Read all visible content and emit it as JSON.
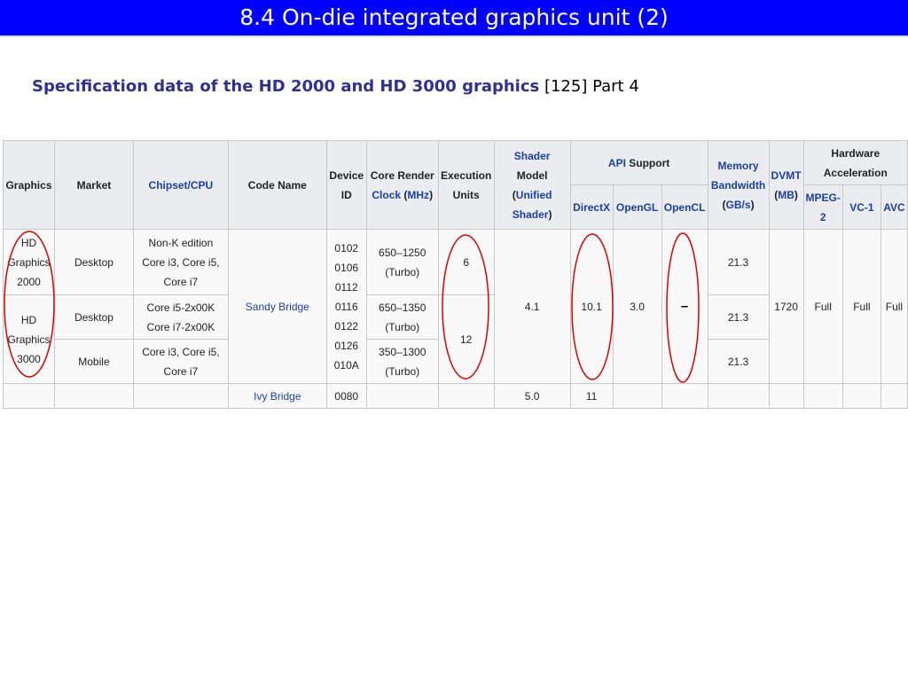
{
  "slide": {
    "title": "8.4 On-die integrated graphics unit (2)",
    "subtitle_bold": "Specification data of the HD 2000 and HD 3000 graphics",
    "subtitle_rest": " [125] Part 4"
  },
  "table": {
    "headers": {
      "graphics": "Graphics",
      "market": "Market",
      "chipset_cpu": "Chipset/CPU",
      "code_name": "Code Name",
      "device_id_1": "Device",
      "device_id_2": "ID",
      "core_clock_1": "Core Render",
      "core_clock_link1": "Clock",
      "core_clock_open": " (",
      "core_clock_link2": "MHz",
      "core_clock_close": ")",
      "eu_1": "Execution",
      "eu_2": "Units",
      "shader_link": "Shader",
      "shader_model": "Model",
      "shader_open": "(",
      "shader_unified_link": "Unified",
      "shader_link2": "Shader",
      "shader_close": ")",
      "api_link": "API",
      "api_support": " Support",
      "directx": "DirectX",
      "opengl": "OpenGL",
      "opencl": "OpenCL",
      "mem_link1": "Memory",
      "mem_link2": "Bandwidth",
      "mem_open": "(",
      "mem_unit_link": "GB/s",
      "mem_close": ")",
      "dvmt_link": "DVMT",
      "dvmt_open": "(",
      "dvmt_unit_link": "MB",
      "dvmt_close": ")",
      "hw_accel_1": "Hardware",
      "hw_accel_2": "Acceleration",
      "mpeg2_1": "MPEG-",
      "mpeg2_2": "2",
      "vc1": "VC-1",
      "avc": "AVC"
    },
    "rows": {
      "r1": {
        "graphics_1": "HD",
        "graphics_2": "Graphics",
        "graphics_3": "2000",
        "market": "Desktop",
        "chipset_1": "Non-K edition",
        "chipset_2": "Core i3, Core i5,",
        "chipset_3": "Core i7",
        "clock_1": "650–1250",
        "clock_2": "(Turbo)",
        "eu": "6",
        "mem_bw": "21.3"
      },
      "r2": {
        "graphics_1": "HD",
        "graphics_2": "Graphics",
        "graphics_3": "3000",
        "market": "Desktop",
        "chipset_1": "Core i5-2x00K",
        "chipset_2": "Core i7-2x00K",
        "clock_1": "650–1350",
        "clock_2": "(Turbo)",
        "eu": "12",
        "mem_bw": "21.3"
      },
      "r3": {
        "market": "Mobile",
        "chipset_1": "Core i3, Core i5,",
        "chipset_2": "Core i7",
        "clock_1": "350–1300",
        "clock_2": "(Turbo)",
        "mem_bw": "21.3"
      },
      "shared": {
        "code_name": "Sandy Bridge",
        "device_ids": [
          "0102",
          "0106",
          "0112",
          "0116",
          "0122",
          "0126",
          "010A"
        ],
        "shader_model": "4.1",
        "directx": "10.1",
        "opengl": "3.0",
        "opencl": "–",
        "dvmt": "1720",
        "mpeg2": "Full",
        "vc1": "Full",
        "avc": "Full"
      },
      "ivy": {
        "code_name": "Ivy Bridge",
        "device_id": "0080",
        "shader_model": "5.0",
        "directx": "11"
      }
    }
  },
  "colors": {
    "title_bar": "#0000ff",
    "subtitle_bold": "#2e3192",
    "link": "#1a3fa8",
    "annotation": "#e00000"
  }
}
